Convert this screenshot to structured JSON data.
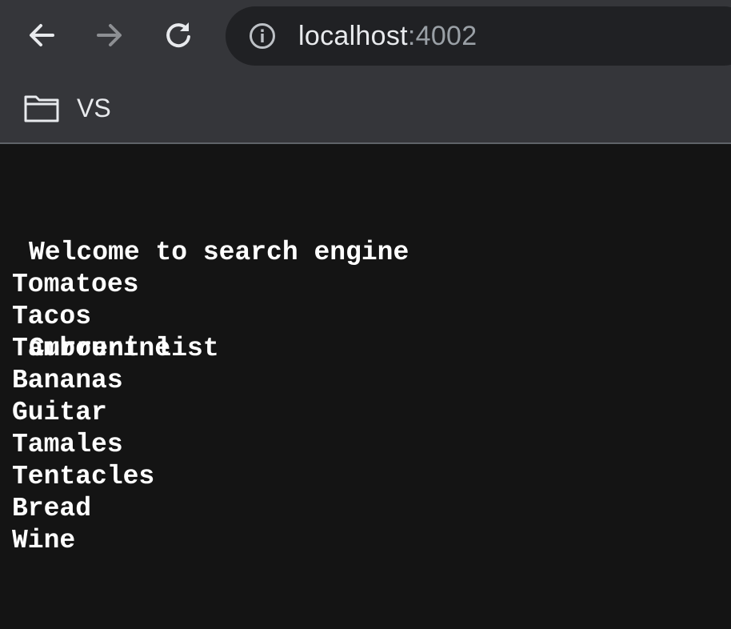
{
  "browser": {
    "url_host": "localhost",
    "url_port": ":4002",
    "icons": {
      "back": "back-arrow-icon",
      "forward": "forward-arrow-icon",
      "reload": "reload-icon",
      "info": "info-icon",
      "folder": "folder-icon"
    },
    "bookmark": {
      "label": "VS"
    }
  },
  "page": {
    "welcome": "Welcome to search engine",
    "current_list": "Current list",
    "items": [
      "Tomatoes",
      "Tacos",
      "Tambourine",
      "Bananas",
      "Guitar",
      "Tamales",
      "Tentacles",
      "Bread",
      "Wine"
    ]
  },
  "colors": {
    "toolbar_bg": "#35363a",
    "omnibox_bg": "#202124",
    "page_bg": "#141414",
    "text": "#ffffff"
  }
}
